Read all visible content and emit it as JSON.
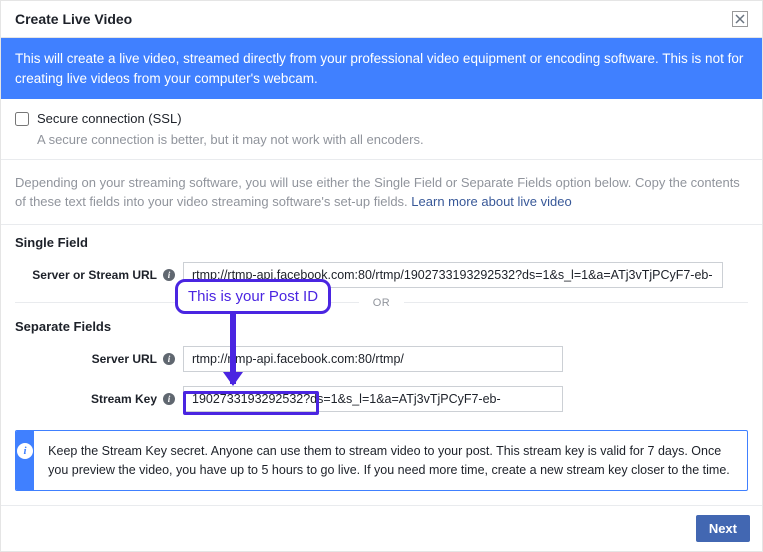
{
  "dialog": {
    "title": "Create Live Video"
  },
  "banner": {
    "text": "This will create a live video, streamed directly from your professional video equipment or encoding software. This is not for creating live videos from your computer's webcam."
  },
  "ssl": {
    "label": "Secure connection (SSL)",
    "help": "A secure connection is better, but it may not work with all encoders."
  },
  "intro": {
    "text_prefix": "Depending on your streaming software, you will use either the Single Field or Separate Fields option below. Copy the contents of these text fields into your video streaming software's set-up fields. ",
    "link_text": "Learn more about live video"
  },
  "single_field": {
    "heading": "Single Field",
    "label": "Server or Stream URL",
    "value": "rtmp://rtmp-api.facebook.com:80/rtmp/1902733193292532?ds=1&s_l=1&a=ATj3vTjPCyF7-eb-"
  },
  "divider": {
    "label": "OR"
  },
  "separate_fields": {
    "heading": "Separate Fields",
    "server_label": "Server URL",
    "server_value": "rtmp://rtmp-api.facebook.com:80/rtmp/",
    "key_label": "Stream Key",
    "key_value": "1902733193292532?ds=1&s_l=1&a=ATj3vTjPCyF7-eb-"
  },
  "info_box": {
    "text": "Keep the Stream Key secret. Anyone can use them to stream video to your post. This stream key is valid for 7 days. Once you preview the video, you have up to 5 hours to go live. If you need more time, create a new stream key closer to the time."
  },
  "footer": {
    "next": "Next"
  },
  "annotation": {
    "label": "This is your Post ID"
  }
}
